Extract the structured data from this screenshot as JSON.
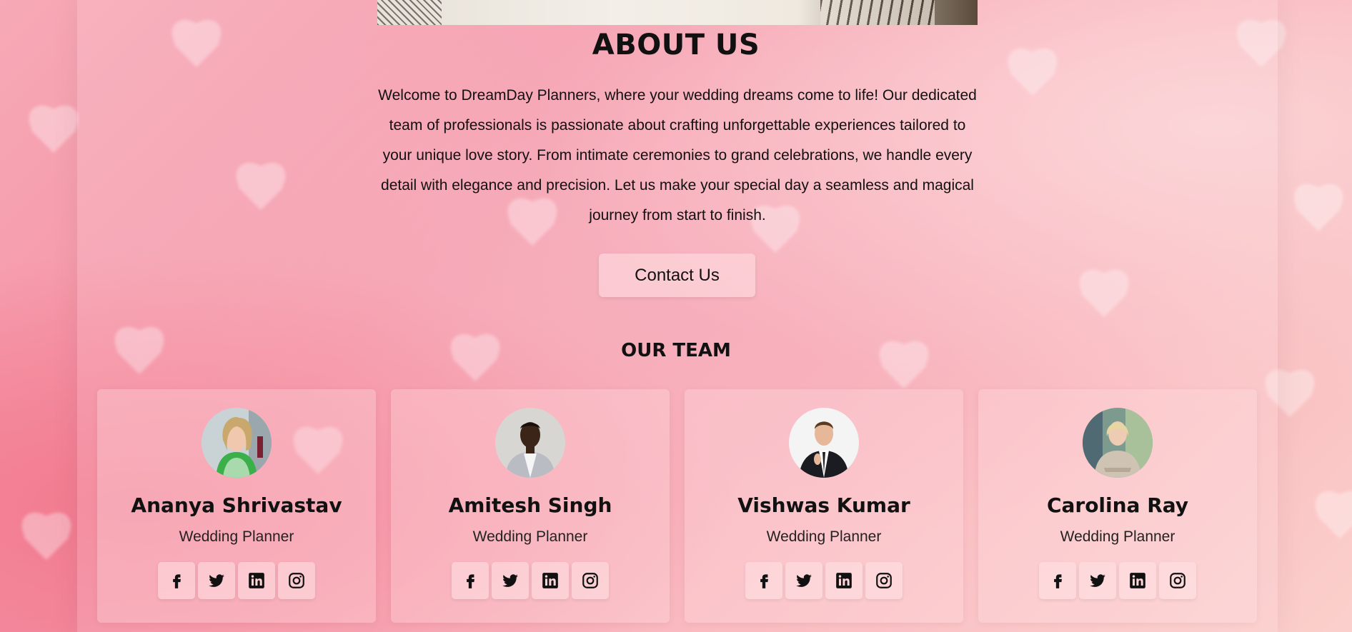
{
  "about": {
    "title": "ABOUT US",
    "text": "Welcome to DreamDay Planners, where your wedding dreams come to life! Our dedicated team of professionals is passionate about crafting unforgettable experiences tailored to your unique love story. From intimate ceremonies to grand celebrations, we handle every detail with elegance and precision. Let us make your special day a seamless and magical journey from start to finish.",
    "contact_label": "Contact Us"
  },
  "team": {
    "title": "OUR TEAM",
    "members": [
      {
        "name": "Ananya Shrivastav",
        "role": "Wedding Planner"
      },
      {
        "name": "Amitesh Singh",
        "role": "Wedding Planner"
      },
      {
        "name": "Vishwas Kumar",
        "role": "Wedding Planner"
      },
      {
        "name": "Carolina Ray",
        "role": "Wedding Planner"
      }
    ],
    "social_icons": [
      "facebook-icon",
      "twitter-icon",
      "linkedin-icon",
      "instagram-icon"
    ]
  },
  "colors": {
    "background": "#f7a0ae",
    "text": "#111111"
  }
}
